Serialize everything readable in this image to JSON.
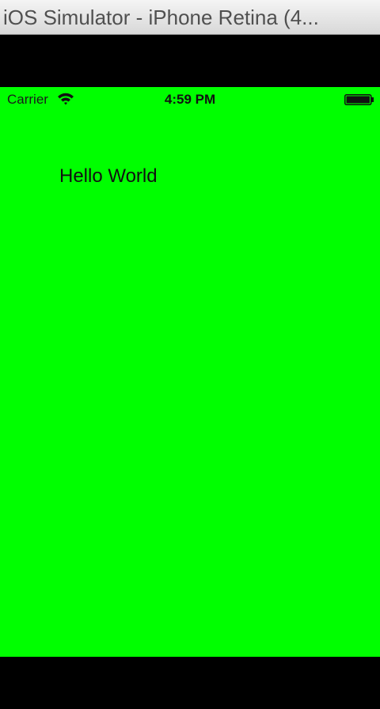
{
  "window": {
    "title": "iOS Simulator - iPhone Retina (4..."
  },
  "screen": {
    "background_color": "#00ff00"
  },
  "status_bar": {
    "carrier": "Carrier",
    "time": "4:59 PM",
    "wifi_icon": "wifi-icon",
    "battery_icon": "battery-icon"
  },
  "content": {
    "label": "Hello World"
  }
}
